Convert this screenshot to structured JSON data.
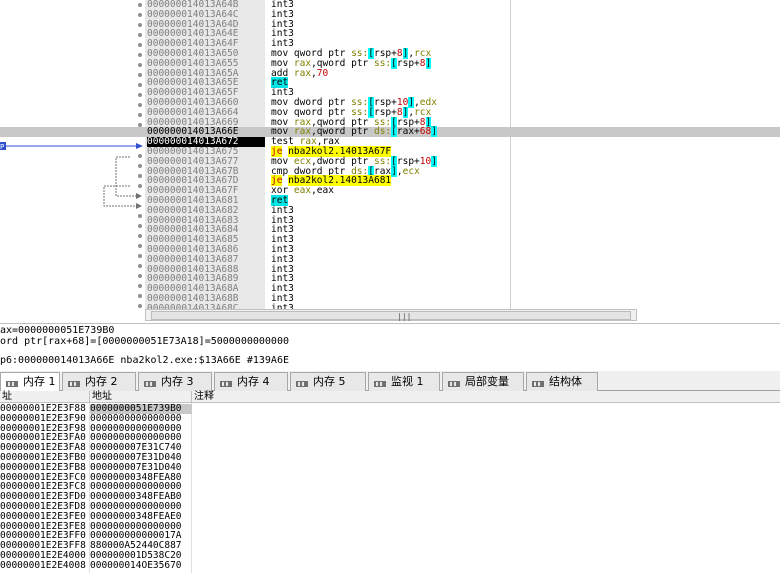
{
  "disasm": {
    "rows": [
      {
        "addr": "000000014013A64B",
        "instr": "int3"
      },
      {
        "addr": "000000014013A64C",
        "instr": "int3"
      },
      {
        "addr": "000000014013A64D",
        "instr": "int3"
      },
      {
        "addr": "000000014013A64E",
        "instr": "int3"
      },
      {
        "addr": "000000014013A64F",
        "instr": "int3"
      },
      {
        "addr": "000000014013A650",
        "instr": "mov qword ptr ss:[rsp+8],rcx"
      },
      {
        "addr": "000000014013A655",
        "instr": "mov rax,qword ptr ss:[rsp+8]"
      },
      {
        "addr": "000000014013A65A",
        "instr": "add rax,70"
      },
      {
        "addr": "000000014013A65E",
        "instr": "ret"
      },
      {
        "addr": "000000014013A65F",
        "instr": "int3"
      },
      {
        "addr": "000000014013A660",
        "instr": "mov dword ptr ss:[rsp+10],edx"
      },
      {
        "addr": "000000014013A664",
        "instr": "mov qword ptr ss:[rsp+8],rcx"
      },
      {
        "addr": "000000014013A669",
        "instr": "mov rax,qword ptr ss:[rsp+8]"
      },
      {
        "addr": "000000014013A66E",
        "instr": "mov rax,qword ptr ds:[rax+68]"
      },
      {
        "addr": "000000014013A672",
        "instr": "test rax,rax"
      },
      {
        "addr": "000000014013A675",
        "instr": "je nba2kol2.14013A67F"
      },
      {
        "addr": "000000014013A677",
        "instr": "mov ecx,dword ptr ss:[rsp+10]"
      },
      {
        "addr": "000000014013A67B",
        "instr": "cmp dword ptr ds:[rax],ecx"
      },
      {
        "addr": "000000014013A67D",
        "instr": "je nba2kol2.14013A681"
      },
      {
        "addr": "000000014013A67F",
        "instr": "xor eax,eax"
      },
      {
        "addr": "000000014013A681",
        "instr": "ret"
      },
      {
        "addr": "000000014013A682",
        "instr": "int3"
      },
      {
        "addr": "000000014013A683",
        "instr": "int3"
      },
      {
        "addr": "000000014013A684",
        "instr": "int3"
      },
      {
        "addr": "000000014013A685",
        "instr": "int3"
      },
      {
        "addr": "000000014013A686",
        "instr": "int3"
      },
      {
        "addr": "000000014013A687",
        "instr": "int3"
      },
      {
        "addr": "000000014013A688",
        "instr": "int3"
      },
      {
        "addr": "000000014013A689",
        "instr": "int3"
      },
      {
        "addr": "000000014013A68A",
        "instr": "int3"
      },
      {
        "addr": "000000014013A68B",
        "instr": "int3"
      },
      {
        "addr": "000000014013A68C",
        "instr": "int3"
      }
    ],
    "arrow_label": "P"
  },
  "info": {
    "line1": "ax=0000000051E739B0",
    "line2": "ord ptr[rax+68]=[0000000051E73A18]=5000000000000",
    "line3": "p6:000000014013A66E nba2kol2.exe:$13A66E #139A6E"
  },
  "tabs": [
    {
      "label": "内存 1",
      "active": true,
      "icon": "memory-icon"
    },
    {
      "label": "内存 2",
      "active": false,
      "icon": "memory-icon"
    },
    {
      "label": "内存 3",
      "active": false,
      "icon": "memory-icon"
    },
    {
      "label": "内存 4",
      "active": false,
      "icon": "memory-icon"
    },
    {
      "label": "内存 5",
      "active": false,
      "icon": "memory-icon"
    },
    {
      "label": "监视 1",
      "active": false,
      "icon": "watch-icon"
    },
    {
      "label": "局部变量",
      "active": false,
      "icon": "locals-icon"
    },
    {
      "label": "结构体",
      "active": false,
      "icon": "struct-icon"
    }
  ],
  "dump": {
    "headers": [
      "址",
      "地址",
      "注释"
    ],
    "rows": [
      {
        "a": "00000001E2E3F88",
        "v": "0000000051E739B0"
      },
      {
        "a": "00000001E2E3F90",
        "v": "0000000000000000"
      },
      {
        "a": "00000001E2E3F98",
        "v": "0000000000000000"
      },
      {
        "a": "00000001E2E3FA0",
        "v": "0000000000000000"
      },
      {
        "a": "00000001E2E3FA8",
        "v": "000000007E31C740"
      },
      {
        "a": "00000001E2E3FB0",
        "v": "000000007E31D040"
      },
      {
        "a": "00000001E2E3FB8",
        "v": "000000007E31D040"
      },
      {
        "a": "00000001E2E3FC0",
        "v": "00000000348FEA80"
      },
      {
        "a": "00000001E2E3FC8",
        "v": "0000000000000000"
      },
      {
        "a": "00000001E2E3FD0",
        "v": "00000000348FEAB0"
      },
      {
        "a": "00000001E2E3FD8",
        "v": "0000000000000000"
      },
      {
        "a": "00000001E2E3FE0",
        "v": "00000000348FEAE0"
      },
      {
        "a": "00000001E2E3FE8",
        "v": "0000000000000000"
      },
      {
        "a": "00000001E2E3FF0",
        "v": "000000000000017A"
      },
      {
        "a": "00000001E2E3FF8",
        "v": "880000A52440C887"
      },
      {
        "a": "00000001E2E4000",
        "v": "000000001D538C20"
      },
      {
        "a": "00000001E2E4008",
        "v": "000000014OE35670"
      }
    ]
  }
}
